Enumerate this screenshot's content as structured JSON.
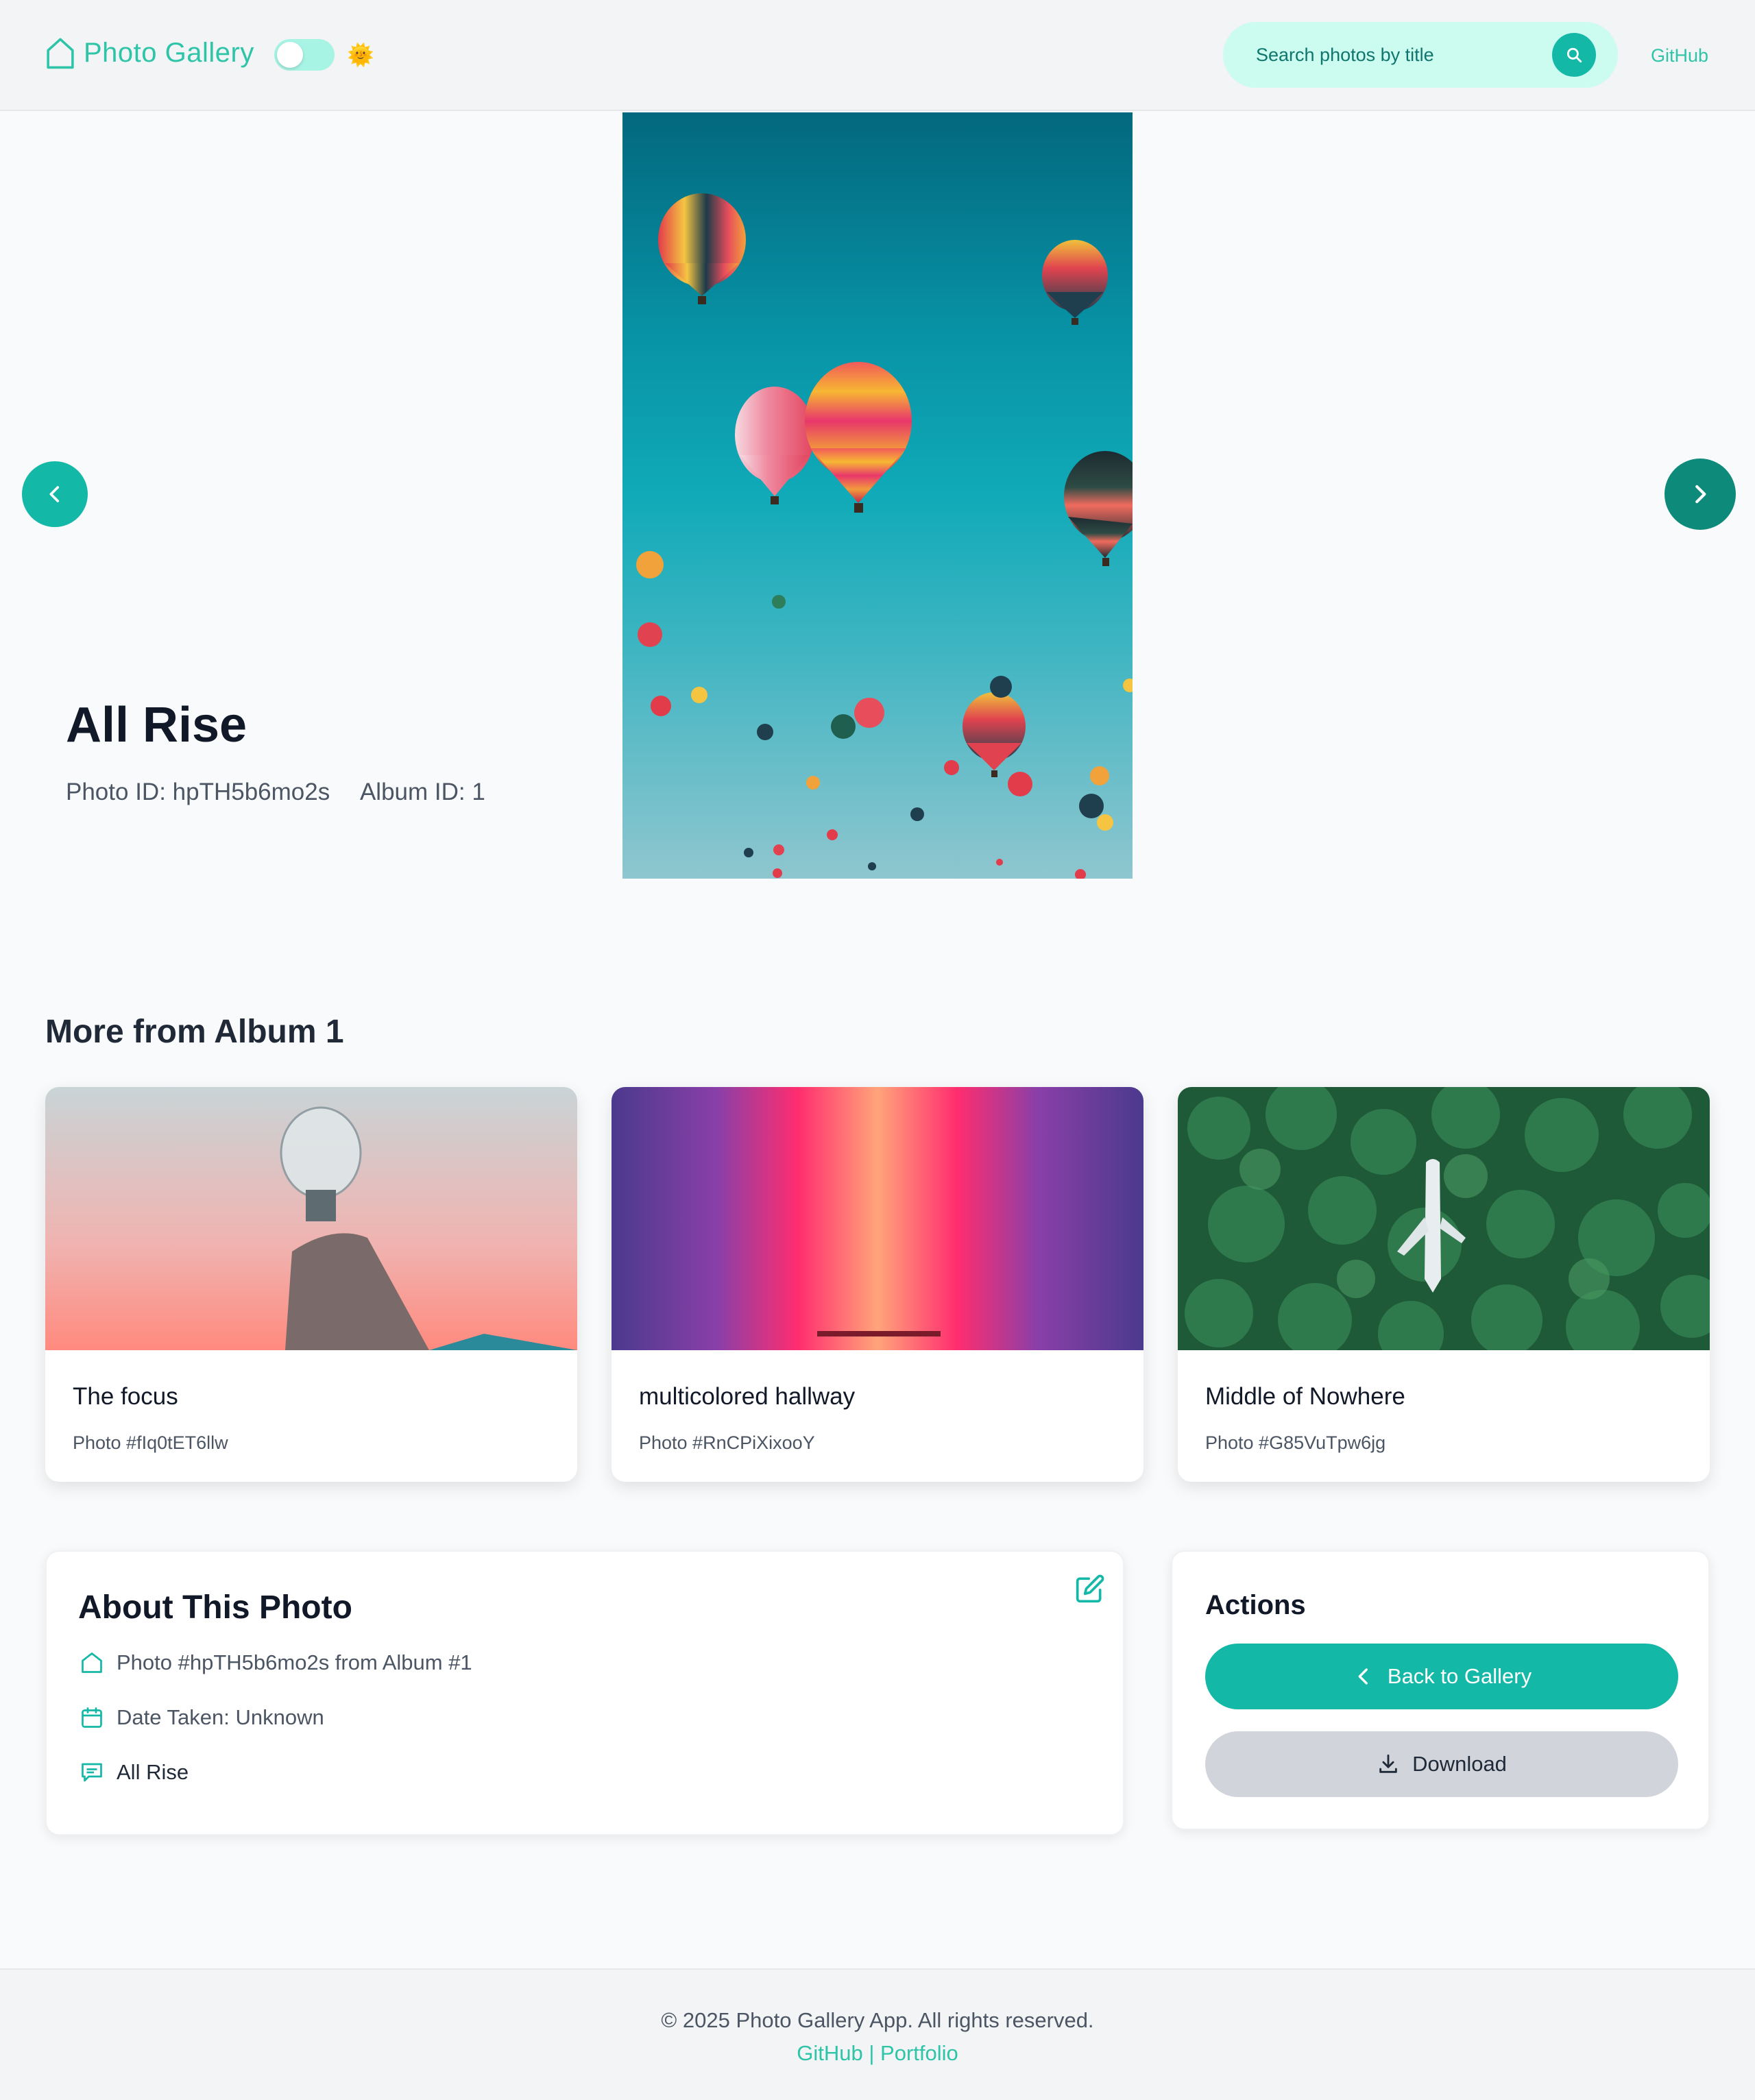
{
  "header": {
    "brand": "Photo Gallery",
    "theme_emoji": "🌞",
    "search_placeholder": "Search photos by title",
    "github_label": "GitHub"
  },
  "hero": {
    "title": "All Rise",
    "photo_id_text": "Photo ID: hpTH5b6mo2s",
    "album_id_text": "Album ID: 1"
  },
  "more": {
    "title": "More from Album 1",
    "cards": [
      {
        "title": "The focus",
        "subtitle": "Photo #fIq0tET6llw"
      },
      {
        "title": "multicolored hallway",
        "subtitle": "Photo #RnCPiXixooY"
      },
      {
        "title": "Middle of Nowhere",
        "subtitle": "Photo #G85VuTpw6jg"
      }
    ]
  },
  "about": {
    "title": "About This Photo",
    "rows": [
      {
        "icon": "home-icon",
        "text": "Photo #hpTH5b6mo2s from Album #1"
      },
      {
        "icon": "calendar-icon",
        "text": "Date Taken: Unknown"
      },
      {
        "icon": "comment-icon",
        "text": "All Rise"
      }
    ]
  },
  "actions": {
    "title": "Actions",
    "back_label": "Back to Gallery",
    "download_label": "Download"
  },
  "footer": {
    "copyright": "© 2025 Photo Gallery App. All rights reserved.",
    "github": "GitHub",
    "separator": "|",
    "portfolio": "Portfolio"
  },
  "colors": {
    "accent": "#14b8a6",
    "accent_light": "#ccfbef",
    "accent_text": "#2dc4a8",
    "background": "#f9fafb"
  }
}
